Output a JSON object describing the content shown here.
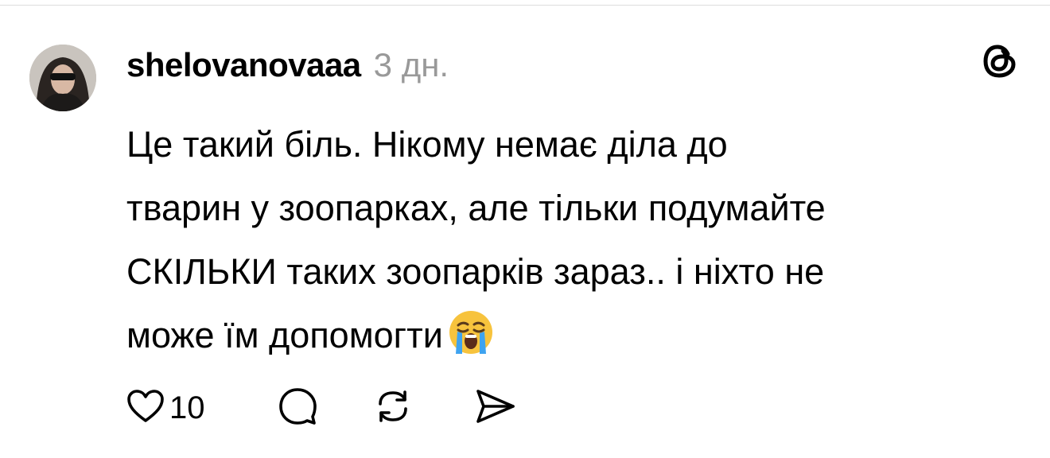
{
  "post": {
    "username": "shelovanovaaa",
    "timestamp": "3 дн.",
    "body_lines": [
      "Це такий біль. Нікому немає діла до",
      "тварин у зоопарках, але тільки подумайте",
      "СКІЛЬКИ таких зоопарків зараз.. і ніхто не",
      "може їм допомогти"
    ],
    "emoji": "loudly-crying-face"
  },
  "actions": {
    "like_count": "10",
    "icons": [
      "heart-icon",
      "comment-icon",
      "repost-icon",
      "share-icon"
    ]
  },
  "branding": {
    "logo": "threads-logo-icon"
  },
  "colors": {
    "text": "#000000",
    "muted": "#999999",
    "background": "#ffffff",
    "divider": "#dcdcdc"
  }
}
